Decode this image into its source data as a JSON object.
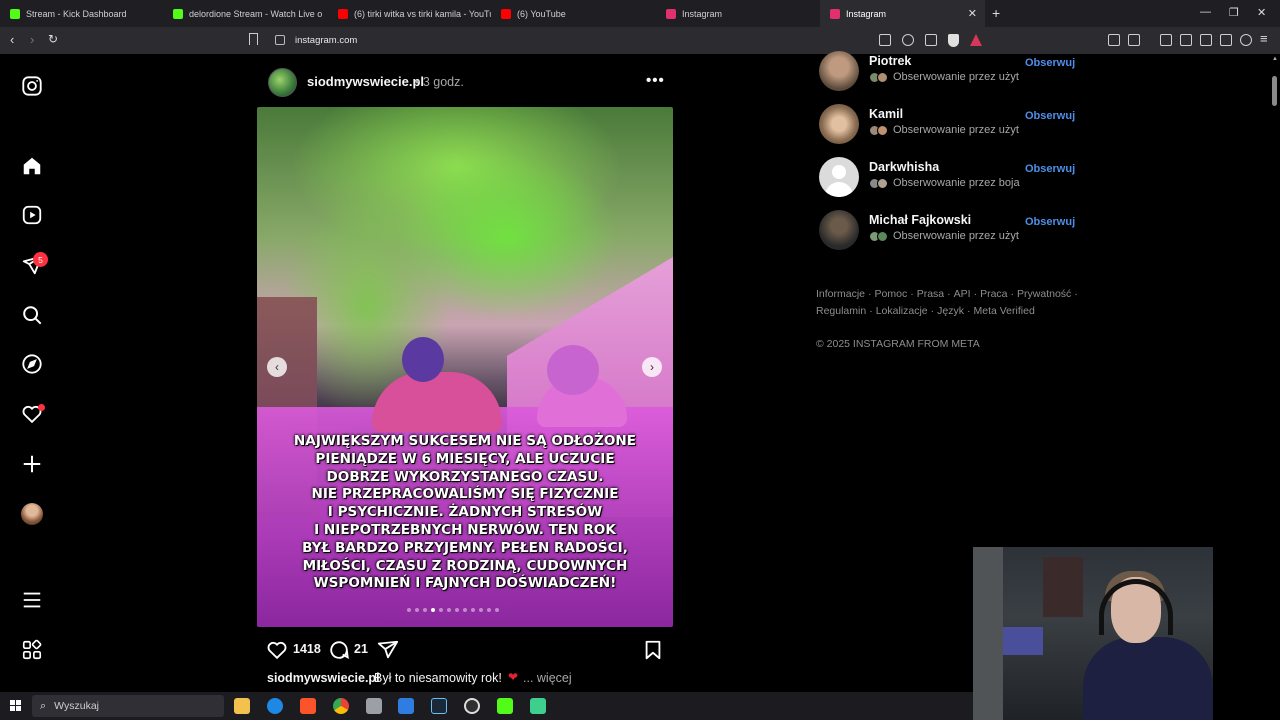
{
  "browser": {
    "tabs": [
      {
        "label": "Stream - Kick Dashboard",
        "color": "#53fc18"
      },
      {
        "label": "delordione Stream - Watch Live o",
        "color": "#53fc18"
      },
      {
        "label": "(6) tirki witka vs tirki kamila - YouTub",
        "color": "#ff0000"
      },
      {
        "label": "(6) YouTube",
        "color": "#ff0000"
      },
      {
        "label": "Instagram",
        "color": "#e1306c"
      },
      {
        "label": "Instagram",
        "color": "#e1306c"
      }
    ],
    "new_tab": "+",
    "url": "instagram.com",
    "window_controls": [
      "—",
      "❐",
      "✕"
    ]
  },
  "sidebar": {
    "logo": "instagram-logo-icon",
    "items": [
      "home-icon",
      "reels-icon",
      "messages-icon",
      "search-icon",
      "explore-icon",
      "notifications-icon",
      "create-icon",
      "profile-icon",
      "more-icon",
      "threads-icon"
    ],
    "messages_badge": "5"
  },
  "post": {
    "username": "siodmywswiecie.pl",
    "time": "• 3 godz.",
    "more": "•••",
    "image_caption": "NAJWIĘKSZYM SUKCESEM NIE SĄ ODŁOŻONE\nPIENIĄDZE W 6 MIESIĘCY, ALE UCZUCIE\nDOBRZE WYKORZYSTANEGO CZASU.\nNIE PRZEPRACOWALIŚMY SIĘ FIZYCZNIE\nI PSYCHICZNIE. ŻADNYCH STRESÓW\nI NIEPOTRZEBNYCH NERWÓW. TEN ROK\nBYŁ BARDZO PRZYJEMNY. PEŁEN RADOŚCI,\nMIŁOŚCI, CZASU Z RODZINĄ, CUDOWNYCH\nWSPOMNIEŃ I FAJNYCH DOŚWIADCZEŃ!",
    "prev": "‹",
    "next": "›",
    "carousel_count": 12,
    "carousel_active": 3,
    "likes": "1418",
    "comments": "21",
    "caption_user": "siodmywswiecie.pl",
    "caption_text": "Był to niesamowity rok!",
    "caption_heart": "❤",
    "caption_more": "... więcej"
  },
  "suggestions": [
    {
      "name": "Piotrek",
      "sub": "Obserwowanie przez użyt",
      "follow": "Obserwuj",
      "avatar": "#8a7a6a"
    },
    {
      "name": "Kamil",
      "sub": "Obserwowanie przez użyt",
      "follow": "Obserwuj",
      "avatar": "#b09070"
    },
    {
      "name": "Darkwhisha",
      "sub": "Obserwowanie przez boja",
      "follow": "Obserwuj",
      "avatar": "#d9d9d9"
    },
    {
      "name": "Michał Fajkowski",
      "sub": "Obserwowanie przez użyt",
      "follow": "Obserwuj",
      "avatar": "#4a4a4a"
    }
  ],
  "footer": {
    "links_line1": [
      "Informacje",
      "Pomoc",
      "Prasa",
      "API",
      "Praca",
      "Prywatność"
    ],
    "links_line2": [
      "Regulamin",
      "Lokalizacje",
      "Język",
      "Meta Verified"
    ],
    "copyright": "© 2025 INSTAGRAM FROM META"
  },
  "taskbar": {
    "search_placeholder": "Wyszukaj",
    "apps": [
      "file-explorer-icon",
      "edge-icon",
      "brave-icon",
      "chrome-icon",
      "app-icon",
      "store-icon",
      "steam-icon",
      "obs-icon",
      "kick-icon",
      "streamer-app-icon"
    ]
  }
}
